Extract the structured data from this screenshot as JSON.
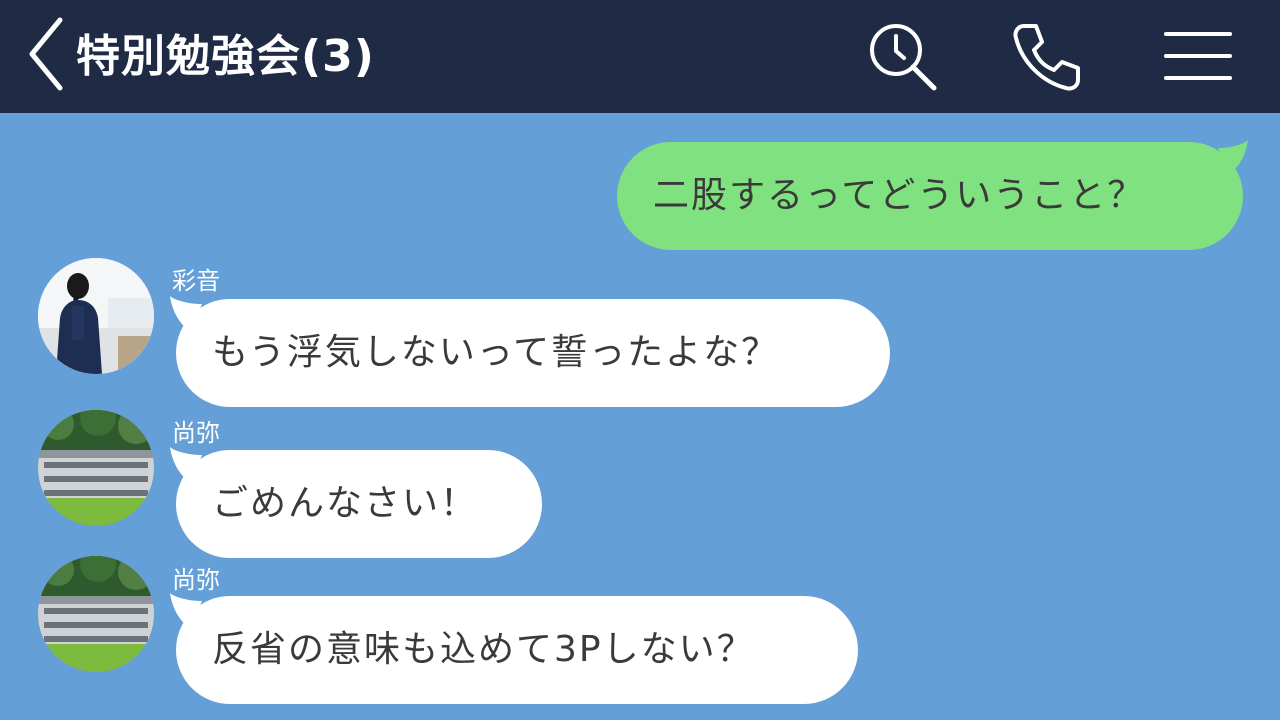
{
  "header": {
    "title": "特別勉強会(3)",
    "back_icon": "chevron-left-icon",
    "search_icon": "search-icon",
    "phone_icon": "phone-icon",
    "menu_icon": "menu-icon",
    "colors": {
      "header_bg": "#1f2a44",
      "chat_bg": "#659fd7"
    }
  },
  "messages": [
    {
      "type": "sent",
      "text": "二股するってどういうこと？",
      "color": "#7fe17f"
    },
    {
      "type": "received",
      "sender": "彩音",
      "text": "もう浮気しないって誓ったよな？"
    },
    {
      "type": "received",
      "sender": "尚弥",
      "text": "ごめんなさい！"
    },
    {
      "type": "received",
      "sender": "尚弥",
      "text": "反省の意味も込めて3Pしない？"
    }
  ]
}
